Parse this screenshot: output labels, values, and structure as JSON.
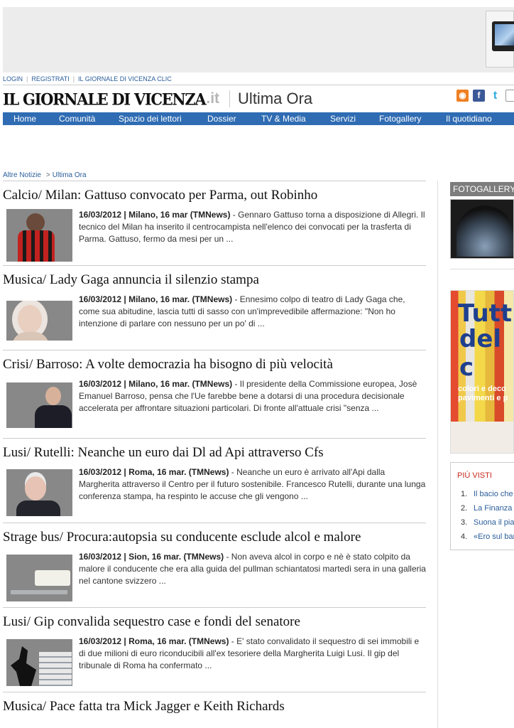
{
  "top_links": [
    "LOGIN",
    "REGISTRATI",
    "IL GIORNALE DI VICENZA CLIC"
  ],
  "logo": {
    "name": "IL GIORNALE DI VICENZA",
    "suffix": ".it"
  },
  "section_title": "Ultima Ora",
  "social_icons": [
    "rss-icon",
    "facebook-icon",
    "twitter-icon",
    "share-icon"
  ],
  "nav": [
    "Home",
    "Comunità",
    "Spazio dei lettori",
    "Dossier",
    "TV & Media",
    "Servizi",
    "Fotogallery",
    "Il quotidiano"
  ],
  "breadcrumb": {
    "parent": "Altre Notizie",
    "separator": ">",
    "current": "Ultima Ora"
  },
  "articles": [
    {
      "title": "Calcio/ Milan: Gattuso convocato per Parma, out Robinho",
      "meta": "16/03/2012 | Milano, 16 mar (TMNews)",
      "body": " - Gennaro Gattuso torna a disposizione di Allegri. Il tecnico del Milan ha inserito il centrocampista nell'elenco dei convocati per la trasferta di Parma. Gattuso, fermo da mesi per un ..."
    },
    {
      "title": "Musica/ Lady Gaga annuncia il silenzio stampa",
      "meta": "16/03/2012 | Milano, 16 mar. (TMNews)",
      "body": " - Ennesimo colpo di teatro di Lady Gaga che, come sua abitudine, lascia tutti di sasso con un'imprevedibile affermazione: \"Non ho intenzione di parlare con nessuno per un po' di ..."
    },
    {
      "title": "Crisi/ Barroso: A volte democrazia ha bisogno di più velocità",
      "meta": "16/03/2012 | Milano, 16 mar. (TMNews)",
      "body": " - Il presidente della Commissione europea, Josè Emanuel Barroso, pensa che l'Ue farebbe bene a dotarsi di una procedura decisionale accelerata per affrontare situazioni particolari. Di fronte all'attuale crisi \"senza ..."
    },
    {
      "title": "Lusi/ Rutelli: Neanche un euro dai Dl ad Api attraverso Cfs",
      "meta": "16/03/2012 | Roma, 16 mar. (TMNews)",
      "body": " - Neanche un euro è arrivato all'Api dalla Margherita attraverso il Centro per il futuro sostenibile. Francesco Rutelli, durante una lunga conferenza stampa, ha respinto le accuse che gli vengono ..."
    },
    {
      "title": "Strage bus/ Procura:autopsia su conducente esclude alcol e malore",
      "meta": "16/03/2012 | Sion, 16 mar. (TMNews)",
      "body": " - Non aveva alcol in corpo e nè è stato colpito da malore il conducente che era alla guida del pullman schiantatosi martedì sera in una galleria nel cantone svizzero ..."
    },
    {
      "title": "Lusi/ Gip convalida sequestro case e fondi del senatore",
      "meta": "16/03/2012 | Roma, 16 mar. (TMNews)",
      "body": " - E' stato convalidato il sequestro di sei immobili e di due milioni di euro riconducibili all'ex tesoriere della Margherita Luigi Lusi. Il gip del tribunale di Roma ha confermato ..."
    },
    {
      "title": "Musica/ Pace fatta tra Mick Jagger e Keith Richards"
    }
  ],
  "sidebar": {
    "fotogallery_title": "FOTOGALLERY",
    "ad_text": [
      "Tutti",
      "del c",
      "colori e deco",
      "pavimenti e p"
    ],
    "piu_visti_title": "PIÙ VISTI",
    "piu_visti": [
      {
        "num": "1.",
        "label": "Il bacio che"
      },
      {
        "num": "2.",
        "label": "La Finanza"
      },
      {
        "num": "3.",
        "label": "Suona il pia"
      },
      {
        "num": "4.",
        "label": "«Ero sul ban"
      }
    ]
  }
}
